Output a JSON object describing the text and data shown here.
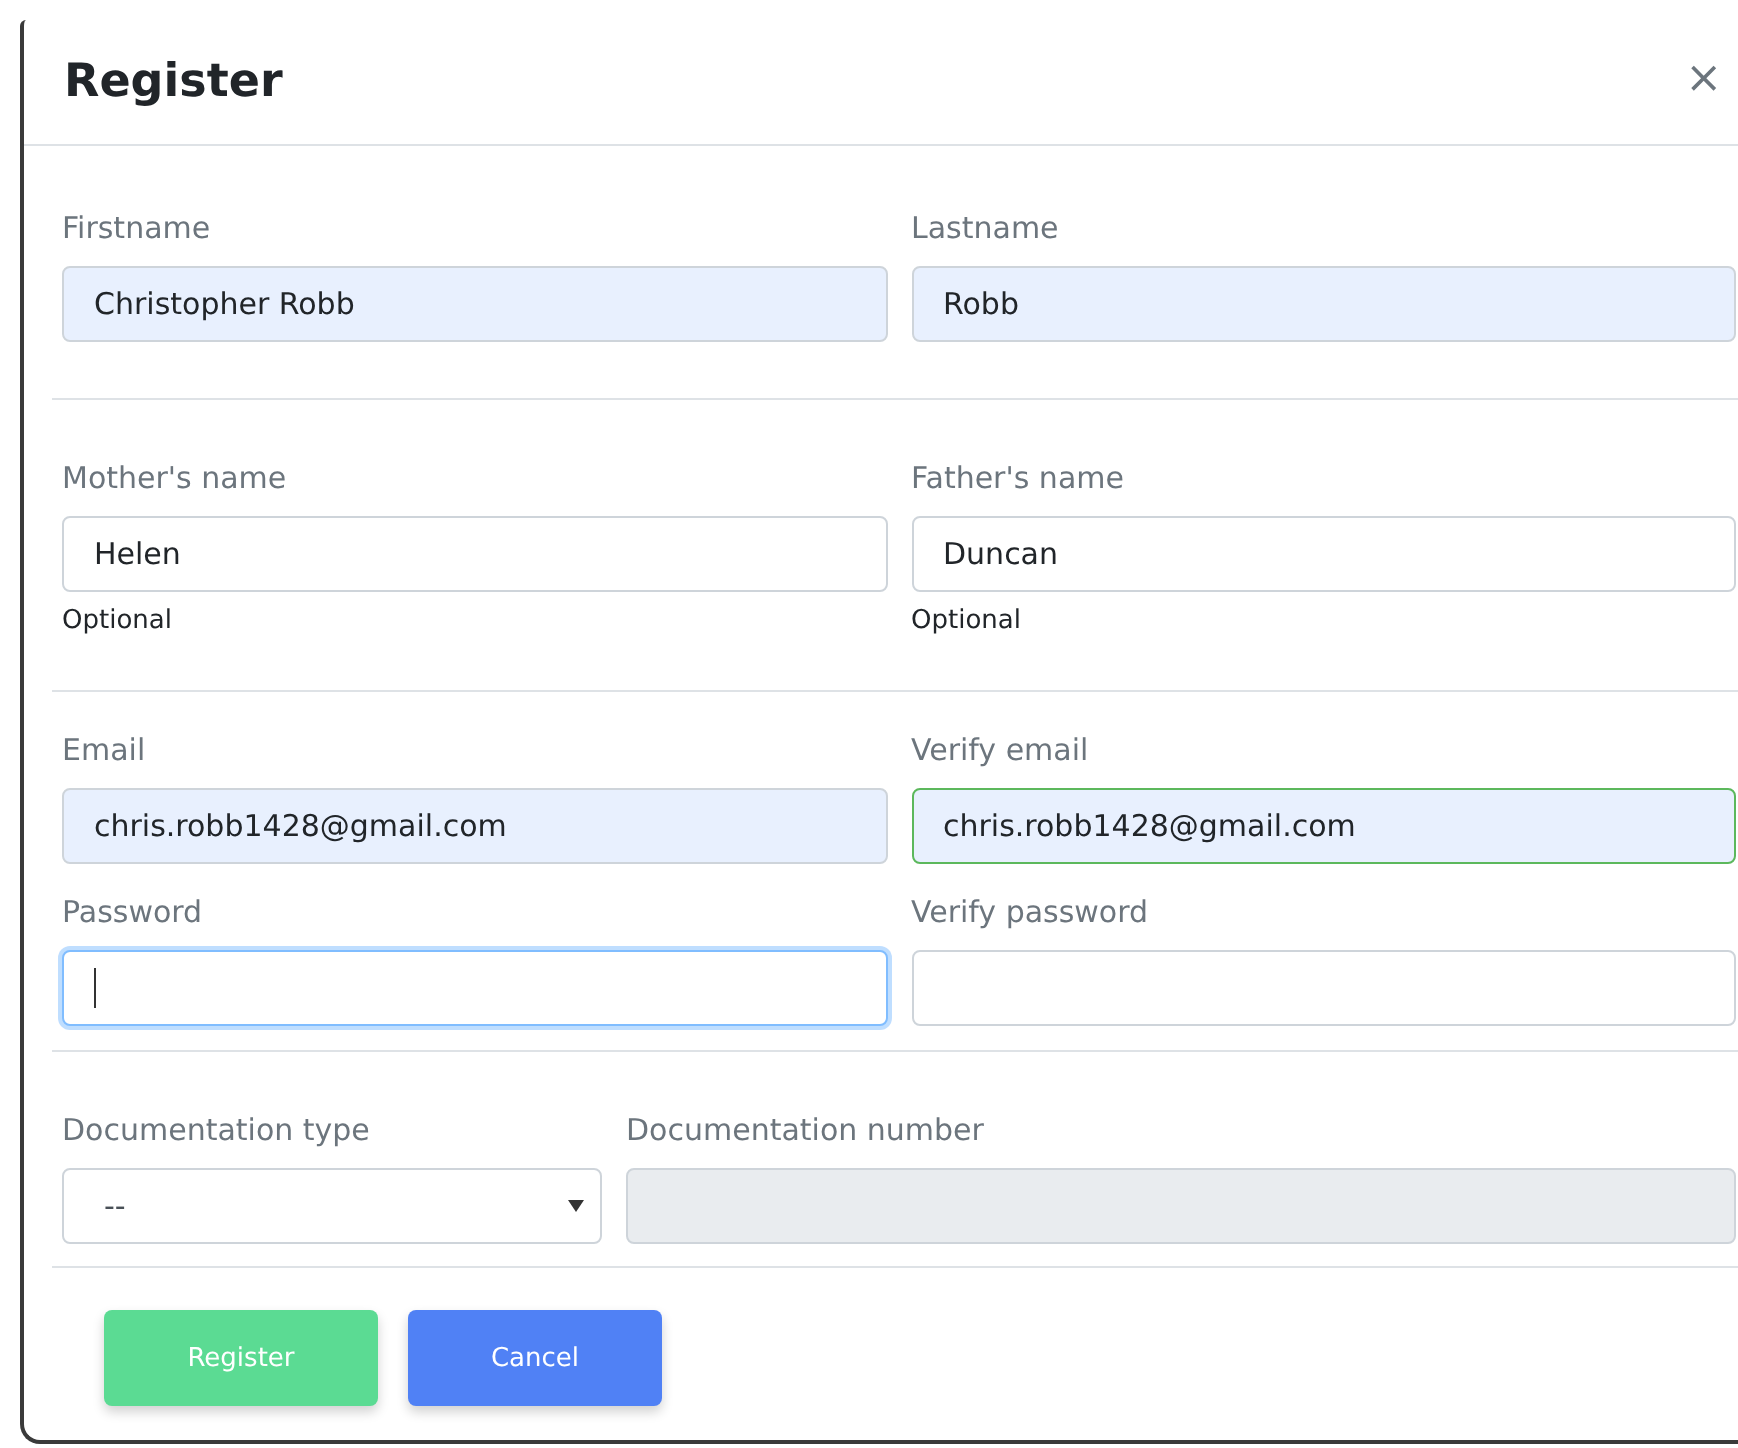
{
  "dialog": {
    "title": "Register",
    "close": "×"
  },
  "sections": [
    {
      "fields": [
        {
          "kind": "input",
          "label": "Firstname",
          "value": "Christopher Robb",
          "autofilled": true,
          "valid": false,
          "focused": false,
          "disabled": false
        },
        {
          "kind": "input",
          "label": "Lastname",
          "value": "Robb",
          "autofilled": true,
          "valid": false,
          "focused": false,
          "disabled": false
        }
      ]
    },
    {
      "fields": [
        {
          "kind": "input",
          "label": "Mother's name",
          "value": "Helen",
          "autofilled": false,
          "valid": false,
          "focused": false,
          "disabled": false,
          "hint": "Optional"
        },
        {
          "kind": "input",
          "label": "Father's name",
          "value": "Duncan",
          "autofilled": false,
          "valid": false,
          "focused": false,
          "disabled": false,
          "hint": "Optional"
        }
      ]
    },
    {
      "fields": [
        {
          "kind": "input",
          "label": "Email",
          "value": "chris.robb1428@gmail.com",
          "autofilled": true,
          "valid": false,
          "focused": false,
          "disabled": false
        },
        {
          "kind": "input",
          "label": "Verify email",
          "value": "chris.robb1428@gmail.com",
          "autofilled": true,
          "valid": true,
          "focused": false,
          "disabled": false
        },
        {
          "kind": "input",
          "label": "Password",
          "autofilled": false,
          "valid": false,
          "focused": true,
          "disabled": false
        },
        {
          "kind": "input",
          "label": "Verify password",
          "autofilled": false,
          "valid": false,
          "focused": false,
          "disabled": false
        }
      ]
    },
    {
      "fields": [
        {
          "kind": "select",
          "label": "Documentation type",
          "value": "--",
          "autofilled": false,
          "valid": false,
          "focused": false,
          "disabled": false
        },
        {
          "kind": "input",
          "label": "Documentation number",
          "autofilled": false,
          "valid": false,
          "focused": false,
          "disabled": true
        }
      ]
    }
  ],
  "buttons": [
    {
      "label": "Register",
      "kind": "primary"
    },
    {
      "label": "Cancel",
      "kind": "secondary"
    }
  ]
}
